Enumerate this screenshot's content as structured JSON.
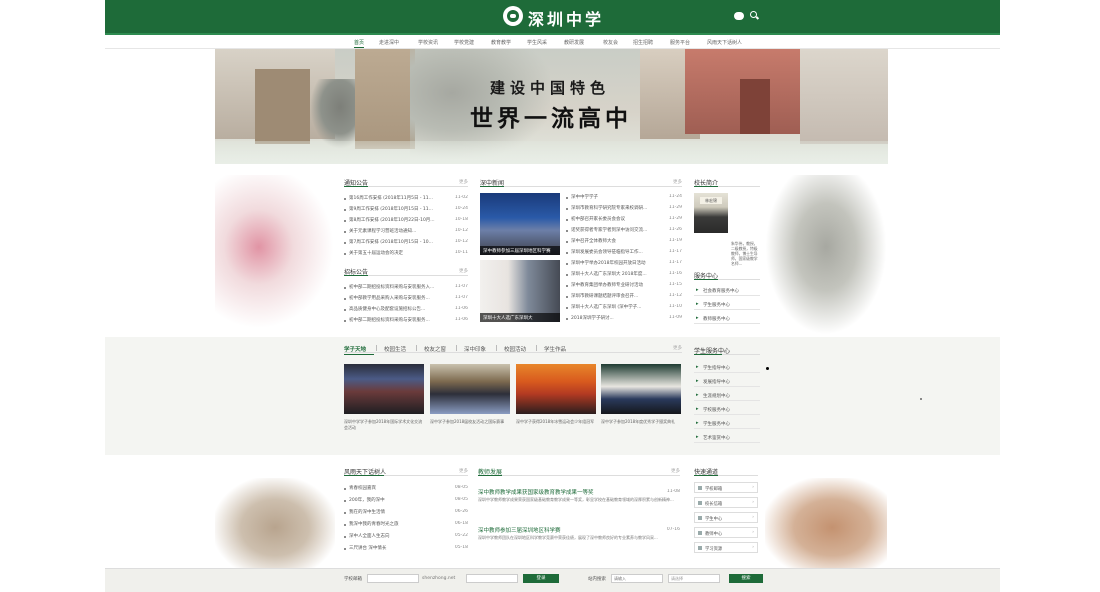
{
  "header": {
    "title": "深圳中学"
  },
  "nav": {
    "items": [
      "首页",
      "走进深中",
      "学校资讯",
      "学校党建",
      "教育教学",
      "学生风采",
      "教研发展",
      "校友会",
      "招生招聘",
      "服务平台",
      "风雨天下话树人"
    ]
  },
  "banner": {
    "slogan_line1": "建设中国特色",
    "slogan_line2": "世界一流高中"
  },
  "notices": {
    "title": "通知公告",
    "more": "更多",
    "items": [
      {
        "text": "第16周工作安排 (2018年11月5日 - 11...",
        "date": "11-02"
      },
      {
        "text": "第9周工作安排 (2018年10月15日 - 11...",
        "date": "10-24"
      },
      {
        "text": "第8周工作安排 (2018年10月22日-10月...",
        "date": "10-18"
      },
      {
        "text": "关于元素课程学习营班活动通知...",
        "date": "10-12"
      },
      {
        "text": "第7周工作安排 (2018年10月15日 - 10...",
        "date": "10-12"
      },
      {
        "text": "关于第五十届运动会的决定",
        "date": "10-11"
      }
    ]
  },
  "tenders": {
    "title": "招标公告",
    "more": "更多",
    "items": [
      {
        "text": "初中部二期招投标资料采购与安装服务入...",
        "date": "11-07"
      },
      {
        "text": "初中部教学用品采购入采购与安装服务...",
        "date": "11-07"
      },
      {
        "text": "高品质健身中心及配套设施招标公告...",
        "date": "11-06"
      },
      {
        "text": "初中部二期招投标资料采购与安装服务...",
        "date": "11-06"
      }
    ]
  },
  "news": {
    "title": "深中新闻",
    "more": "更多",
    "photo1_caption": "深中教师参加三届深圳地区科学赛",
    "photo2_caption": "深圳十大人选广东深圳大",
    "items": [
      {
        "text": "深中中学学子 ",
        "date": "11-24"
      },
      {
        "text": "深圳市教育科学研究院专家来校调研...",
        "date": "11-29"
      },
      {
        "text": "初中部召开家长委员会会议",
        "date": "11-29"
      },
      {
        "text": "诺奖获得者专家学者到深中访问交流...",
        "date": "11-26"
      },
      {
        "text": "深中召开全体教师大会",
        "date": "11-19"
      },
      {
        "text": "深圳发展委员会领导莅临指导工作...",
        "date": "11-17"
      },
      {
        "text": "深圳中学举办2018年校园开放日活动",
        "date": "11-17"
      },
      {
        "text": "深圳十大人选广东深圳大 2018年度...",
        "date": "11-16"
      },
      {
        "text": "深中教育集团举办教师专业研讨活动",
        "date": "11-15"
      },
      {
        "text": "深圳市教研课题结题评审会召开...",
        "date": "11-12"
      },
      {
        "text": "深圳十大人选广东深圳 (深中学子...",
        "date": "11-10"
      },
      {
        "text": "2018深圳学子研讨...",
        "date": "11-09"
      }
    ]
  },
  "profile": {
    "title": "校长简介",
    "sign": "林宏锦",
    "intro": "朱华伟，教授，二级教授，特级教师，博士生导师，国家级教学名师..."
  },
  "services": {
    "title": "服务中心",
    "items": [
      "社会教育服务中心",
      "学生服务中心",
      "教师服务中心"
    ]
  },
  "tabs": {
    "items": [
      "学子天地",
      "校园生活",
      "校友之窗",
      "深中印象",
      "校园活动",
      "学生作品"
    ],
    "more": "更多",
    "thumbs": [
      {
        "caption": "深圳中学学子参加2018年国际学术文化交流会活动"
      },
      {
        "caption": "深中学子参加2018届校友活动之国际赛事"
      },
      {
        "caption": "深中学子获得2018年冰雪运动会少年组冠军"
      },
      {
        "caption": "深中学子参加2018年度优秀学子颁奖典礼"
      }
    ]
  },
  "student_service": {
    "title": "学生服务中心",
    "items": [
      "学生指导中心",
      "发展指导中心",
      "生涯规划中心",
      "学校服务中心",
      "学生服务中心",
      "艺术鉴赏中心"
    ]
  },
  "alumni": {
    "title": "风雨天下话树人",
    "more": "更多",
    "items": [
      {
        "text": "青春校园嘉宾 ",
        "date": "08-05"
      },
      {
        "text": "200年，我的深中",
        "date": "08-05"
      },
      {
        "text": "我在的深中生活情",
        "date": "06-26"
      },
      {
        "text": "我深中我的青春时光之旅",
        "date": "06-18"
      },
      {
        "text": "深中人全面人生志向",
        "date": "05-22"
      },
      {
        "text": "三尺讲台 深中情长",
        "date": "05-18"
      }
    ]
  },
  "teaching": {
    "title": "教师发展",
    "more": "更多",
    "n1_title": "深中教师教学成果获国家级教育教学成果一等奖",
    "n1_date": "11-08",
    "n1_body": "深圳中学教师教学成果荣获国家级基础教育教学成果一等奖，彰显学校在基础教育领域的深厚积累与创新精神...",
    "n2_title": "深中教师参加三届深圳地区科学赛",
    "n2_date": "07-16",
    "n2_body": "深圳中学教师团队在深圳地区科学教学竞赛中荣获佳绩，展现了深中教师良好的专业素养与教学风采..."
  },
  "quick_links": {
    "title": "快速通道",
    "items": [
      "学校邮箱",
      "校长信箱",
      "学生中心",
      "教师中心",
      "学习资源"
    ]
  },
  "footer": {
    "email_label": "学校邮箱",
    "email_domain": "shenzhong.net",
    "login": "登录",
    "search_label": "站内搜索",
    "search_placeholder": "请输入",
    "search_option": "请选择",
    "search_button": "搜索"
  }
}
